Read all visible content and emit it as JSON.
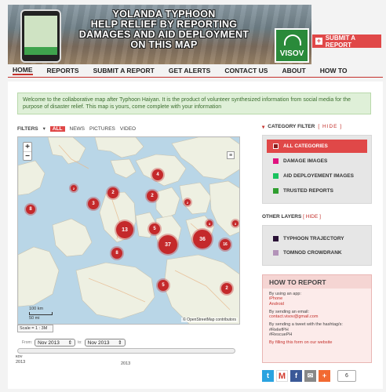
{
  "banner": {
    "title_lines": [
      "YOLANDA TYPHOON",
      "HELP RELIEF BY REPORTING",
      "DAMAGES AND AID DEPLOYMENT",
      "ON THIS MAP"
    ],
    "logo_text": "VISOV"
  },
  "header": {
    "submit_label": "SUBMIT A REPORT"
  },
  "nav": {
    "items": [
      "HOME",
      "REPORTS",
      "SUBMIT A REPORT",
      "GET ALERTS",
      "CONTACT US",
      "ABOUT",
      "HOW TO"
    ],
    "active": "HOME"
  },
  "welcome": "Welcome to the collaborative map after Typhoon Haiyan. It is the product of volunteer synthesized information from social media for the purpose of disaster relief. This map is yours, come complete with your information",
  "filters": {
    "label": "FILTERS",
    "options": [
      "ALL",
      "NEWS",
      "PICTURES",
      "VIDEO"
    ],
    "active": "ALL"
  },
  "map": {
    "zoom_in": "+",
    "zoom_out": "−",
    "scale_km": "100 km",
    "scale_mi": "50 mi",
    "attribution": "© OpenStreetMap contributors",
    "scale_text": "Scale = 1 : 3M",
    "clusters": [
      "8",
      "2",
      "2",
      "4",
      "3",
      "2",
      "2",
      "3",
      "13",
      "5",
      "3",
      "37",
      "36",
      "16",
      "8",
      "5",
      "2"
    ]
  },
  "timeline": {
    "from_label": "From:",
    "to_label": "to:",
    "from_value": "Nov 2013",
    "to_value": "Nov 2013",
    "left_label_1": "κον",
    "left_label_2": "2013",
    "mid_label": "2013"
  },
  "category_filter": {
    "title": "CATEGORY FILTER",
    "hide": "[ HIDE ]",
    "items": [
      {
        "label": "ALL CATEGORIES",
        "color": "#8b1a1a",
        "active": true
      },
      {
        "label": "DAMAGE IMAGES",
        "color": "#e0117f",
        "active": false
      },
      {
        "label": "AID DEPLOYEMENT IMAGES",
        "color": "#18c25e",
        "active": false
      },
      {
        "label": "TRUSTED REPORTS",
        "color": "#2f9e2f",
        "active": false
      }
    ]
  },
  "other_layers": {
    "title": "OTHER LAYERS",
    "hide": "[ HIDE ]",
    "items": [
      {
        "label": "TYPHOON TRAJECTORY",
        "color": "#2a1236"
      },
      {
        "label": "TOMNOD CROWDRANK",
        "color": "#b393b9"
      }
    ]
  },
  "how_to": {
    "title": "HOW TO REPORT",
    "app_intro": "By using an app:",
    "app_1": "iPhone",
    "app_2": "Android",
    "email_intro": "By sending an email:",
    "email": "contact.visov@gmail.com",
    "tweet_intro": "By sending a tweet with the hashtag/s:",
    "tag_1": "#ReliefPH",
    "tag_2": "#RescuePH",
    "form": "By filling this form on our website"
  },
  "share": {
    "count": "6",
    "buttons": [
      "t",
      "M",
      "f",
      "✉",
      "+"
    ]
  }
}
